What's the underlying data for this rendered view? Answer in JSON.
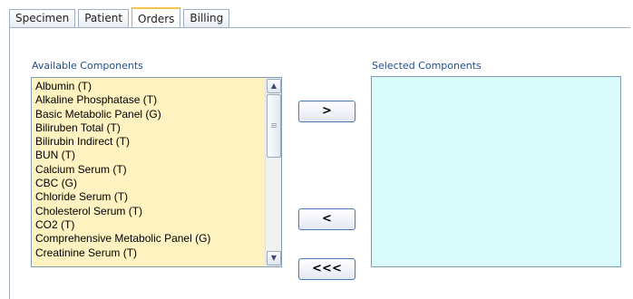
{
  "tabs": [
    {
      "label": "Specimen"
    },
    {
      "label": "Patient"
    },
    {
      "label": "Orders"
    },
    {
      "label": "Billing"
    }
  ],
  "active_tab": "Orders",
  "available": {
    "label": "Available Components",
    "items": [
      "Albumin (T)",
      "Alkaline Phosphatase (T)",
      "Basic Metabolic Panel (G)",
      "Biliruben Total (T)",
      "Bilirubin Indirect (T)",
      "BUN (T)",
      "Calcium Serum (T)",
      "CBC (G)",
      "Chloride Serum (T)",
      "Cholesterol Serum (T)",
      "CO2 (T)",
      "Comprehensive Metabolic Panel (G)",
      "Creatinine Serum (T)"
    ]
  },
  "selected": {
    "label": "Selected Components",
    "items": []
  },
  "buttons": {
    "add": ">",
    "remove": "<",
    "remove_all": "<<<"
  }
}
